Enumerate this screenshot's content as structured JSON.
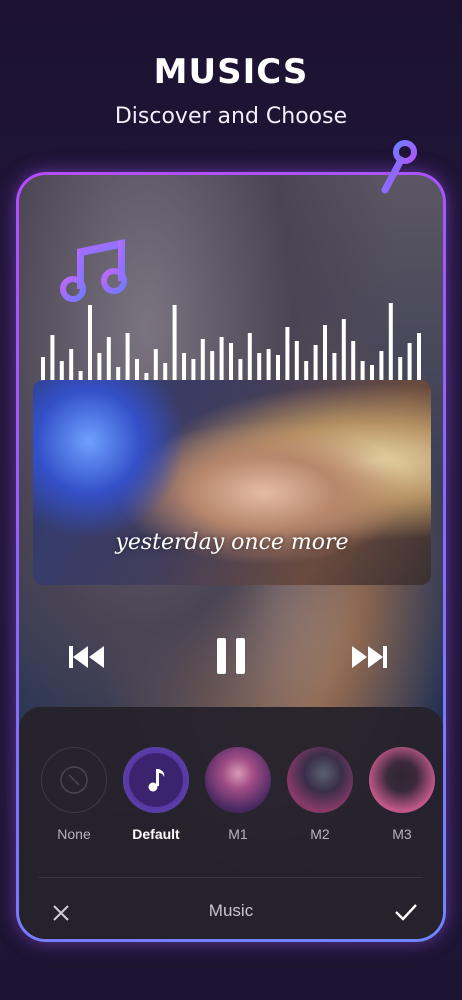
{
  "header": {
    "title": "MUSICS",
    "subtitle": "Discover and Choose"
  },
  "preview": {
    "lyric": "yesterday once more"
  },
  "music_panel": {
    "title": "Music",
    "items": [
      {
        "label": "None",
        "icon": "none-icon",
        "selected": false
      },
      {
        "label": "Default",
        "icon": "music-note-icon",
        "selected": true
      },
      {
        "label": "M1",
        "icon": "thumbnail",
        "selected": false
      },
      {
        "label": "M2",
        "icon": "thumbnail",
        "selected": false
      },
      {
        "label": "M3",
        "icon": "thumbnail",
        "selected": false
      }
    ]
  },
  "colors": {
    "accent": "#8a5cff",
    "frame_start": "#b74bff",
    "frame_end": "#6e86ff"
  }
}
